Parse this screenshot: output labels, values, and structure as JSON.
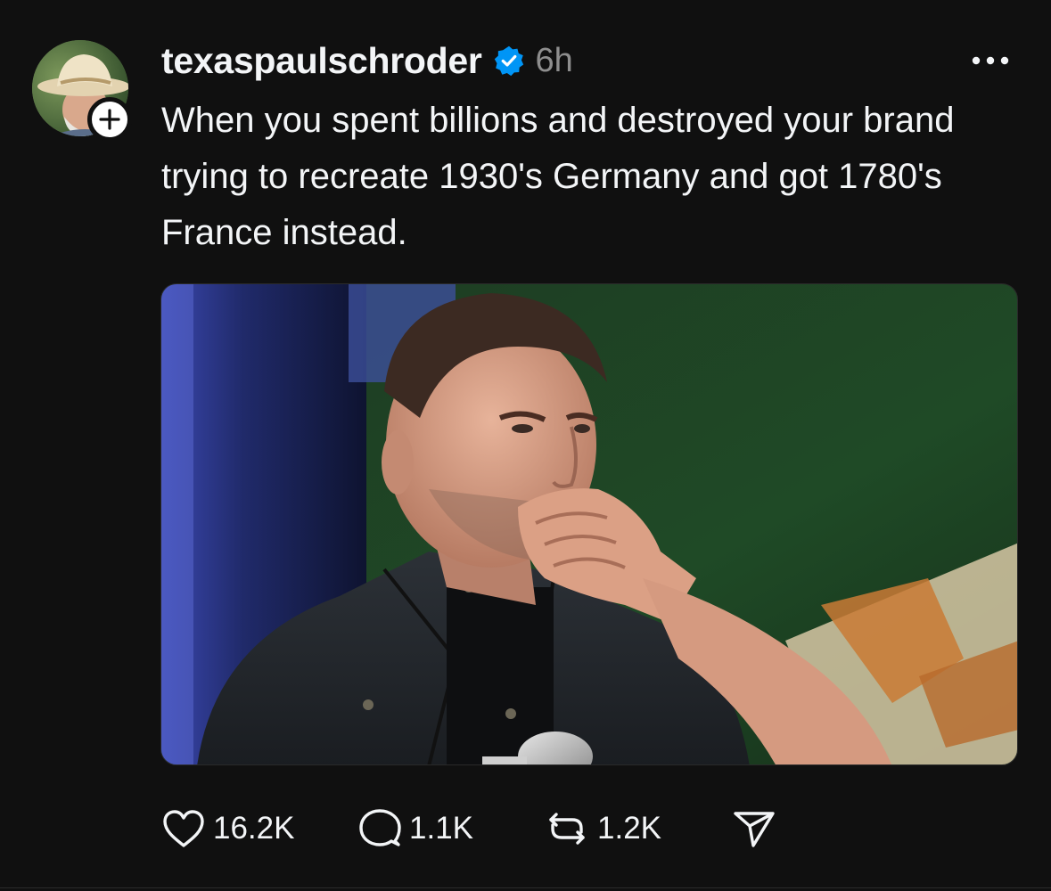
{
  "post": {
    "author": {
      "username": "texaspaulschroder",
      "verified": true,
      "avatar_icon": "avatar-cowboy-hat",
      "follow_icon": "plus-icon"
    },
    "timestamp": "6h",
    "more_icon": "ellipsis-icon",
    "caption": "When you spent billions and destroyed your brand trying to recreate 1930's Germany and got 1780's France instead.",
    "media": {
      "kind": "photo",
      "subject": "man-hand-on-chin-photo"
    },
    "actions": {
      "likes": "16.2K",
      "replies": "1.1K",
      "reposts": "1.2K"
    }
  },
  "colors": {
    "background": "#101010",
    "text_primary": "#f3f5f7",
    "text_secondary": "#8e8e8e",
    "verified_blue": "#0095f6"
  }
}
